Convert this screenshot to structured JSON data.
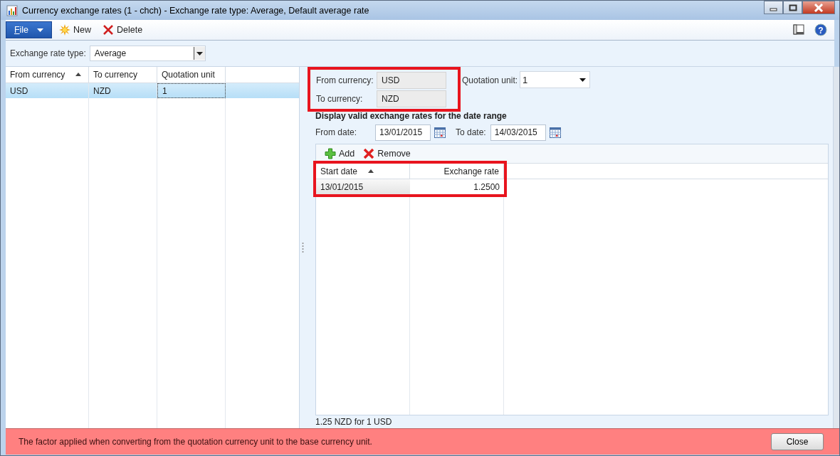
{
  "window": {
    "title": "Currency exchange rates (1 - chch) - Exchange rate type: Average, Default average rate"
  },
  "toolbar": {
    "file_menu": "File",
    "help": "?",
    "buttons": [
      {
        "kind": "new",
        "label": "New"
      },
      {
        "kind": "delete",
        "label": "Delete"
      }
    ]
  },
  "filter": {
    "label": "Exchange rate type:",
    "value": "Average"
  },
  "currency_grid": {
    "columns": [
      {
        "label": "From currency",
        "sorted": true
      },
      {
        "label": "To currency",
        "sorted": false
      },
      {
        "label": "Quotation unit",
        "sorted": false
      }
    ],
    "rows": [
      {
        "cells": [
          "USD",
          "NZD",
          "1"
        ],
        "selected": true
      }
    ]
  },
  "details": {
    "from_currency": {
      "label": "From currency:",
      "value": "USD"
    },
    "to_currency": {
      "label": "To currency:",
      "value": "NZD"
    },
    "quotation_unit": {
      "label": "Quotation unit:",
      "value": "1"
    },
    "section_heading": "Display valid exchange rates for the date range",
    "from_date": {
      "label": "From date:",
      "value": "13/01/2015"
    },
    "to_date": {
      "label": "To date:",
      "value": "14/03/2015"
    },
    "grid_buttons": [
      {
        "kind": "add",
        "label": "Add"
      },
      {
        "kind": "remove",
        "label": "Remove"
      }
    ],
    "rate_grid": {
      "columns": [
        {
          "label": "Start date",
          "sorted": true
        },
        {
          "label": "Exchange rate",
          "sorted": false
        }
      ],
      "rows": [
        {
          "cells": [
            "13/01/2015",
            "1.2500"
          ],
          "selected": true
        }
      ]
    },
    "summary": "1.25 NZD for 1 USD"
  },
  "status_bar": {
    "message": "The factor applied when converting from the quotation currency unit to the base currency unit.",
    "close_button": "Close"
  }
}
